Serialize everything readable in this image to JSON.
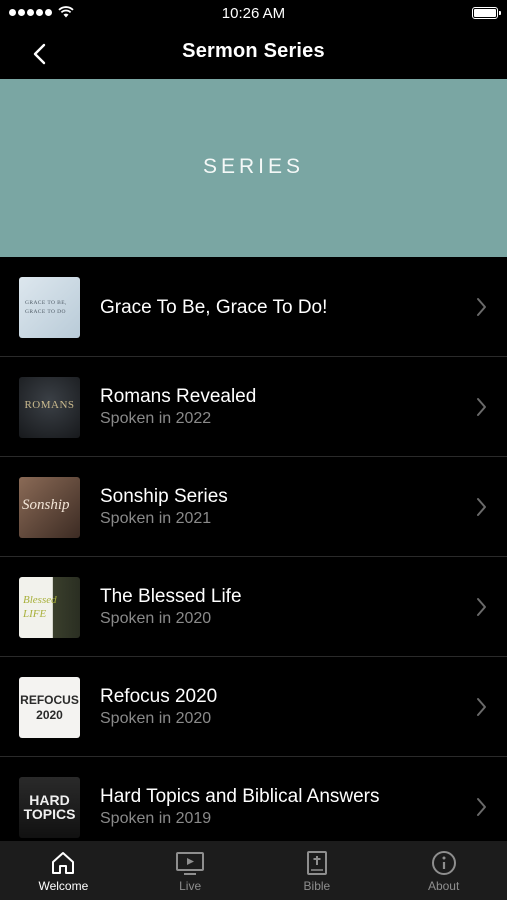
{
  "status_bar": {
    "time": "10:26 AM"
  },
  "nav": {
    "title": "Sermon Series",
    "back_icon": "chevron-left-icon"
  },
  "banner": {
    "text": "SERIES",
    "color": "#7aa6a3"
  },
  "series": [
    {
      "title": "Grace To Be, Grace To Do!",
      "subtitle": "",
      "thumb_text": "GRACE TO BE, GRACE TO DO"
    },
    {
      "title": "Romans Revealed",
      "subtitle": "Spoken in 2022",
      "thumb_text": "ROMANS"
    },
    {
      "title": "Sonship Series",
      "subtitle": "Spoken in 2021",
      "thumb_text": "Sonship"
    },
    {
      "title": "The Blessed Life",
      "subtitle": "Spoken in 2020",
      "thumb_text": "Blessed LIFE"
    },
    {
      "title": "Refocus 2020",
      "subtitle": "Spoken in 2020",
      "thumb_text": "REFOCUS 2020"
    },
    {
      "title": "Hard Topics and Biblical Answers",
      "subtitle": "Spoken in 2019",
      "thumb_text": "HARD TOPICS"
    }
  ],
  "tabs": [
    {
      "label": "Welcome",
      "icon": "home-icon",
      "active": true
    },
    {
      "label": "Live",
      "icon": "tv-play-icon",
      "active": false
    },
    {
      "label": "Bible",
      "icon": "bible-icon",
      "active": false
    },
    {
      "label": "About",
      "icon": "info-icon",
      "active": false
    }
  ]
}
